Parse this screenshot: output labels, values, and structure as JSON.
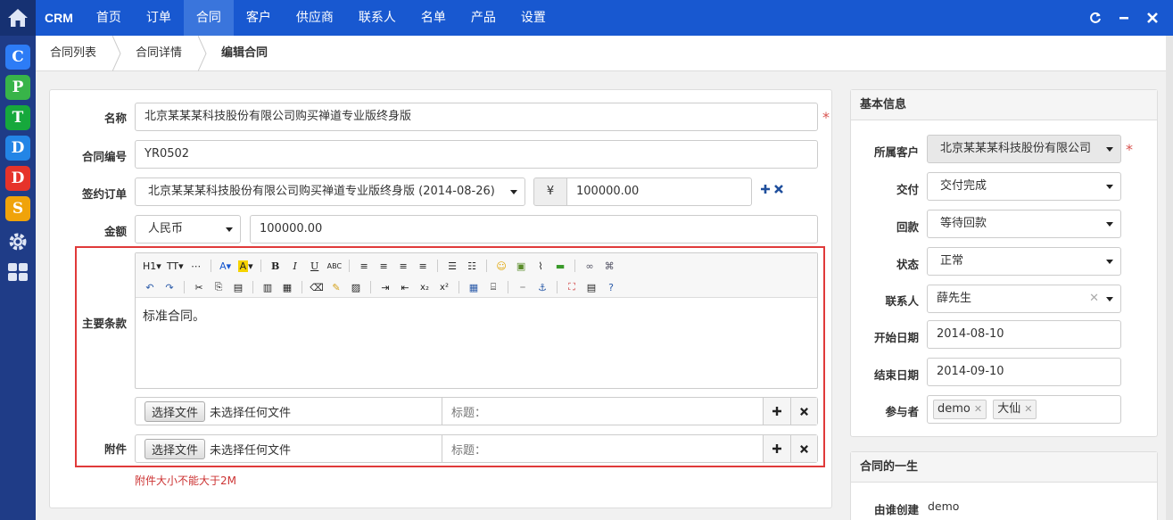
{
  "rail": {
    "apps": [
      {
        "letter": "C",
        "color": "#2d7cf6"
      },
      {
        "letter": "P",
        "color": "#38b449"
      },
      {
        "letter": "T",
        "color": "#16a83c"
      },
      {
        "letter": "D",
        "color": "#2385e6"
      },
      {
        "letter": "D",
        "color": "#e6332a"
      },
      {
        "letter": "S",
        "color": "#f0a30a"
      }
    ]
  },
  "nav": {
    "brand": "CRM",
    "items": [
      "首页",
      "订单",
      "合同",
      "客户",
      "供应商",
      "联系人",
      "名单",
      "产品",
      "设置"
    ],
    "active_index": 2
  },
  "breadcrumb": [
    "合同列表",
    "合同详情",
    "编辑合同"
  ],
  "form": {
    "name_label": "名称",
    "name_value": "北京某某某科技股份有限公司购买禅道专业版终身版",
    "code_label": "合同编号",
    "code_value": "YR0502",
    "order_label": "签约订单",
    "order_value": "北京某某某科技股份有限公司购买禅道专业版终身版 (2014-08-26)",
    "order_currency_symbol": "¥",
    "order_amount": "100000.00",
    "amount_label": "金额",
    "currency_value": "人民币",
    "amount_value": "100000.00",
    "terms_label": "主要条款",
    "terms_text": "标准合同。",
    "attach_label": "附件",
    "file_button": "选择文件",
    "no_file_text": "未选择任何文件",
    "title_placeholder": "标题：",
    "size_warning": "附件大小不能大于2M"
  },
  "editor_toolbar": {
    "heading": "H1",
    "font_size": "TT"
  },
  "basic_info": {
    "header": "基本信息",
    "customer_label": "所属客户",
    "customer_value": "北京某某某科技股份有限公司",
    "delivery_label": "交付",
    "delivery_value": "交付完成",
    "payment_label": "回款",
    "payment_value": "等待回款",
    "status_label": "状态",
    "status_value": "正常",
    "contact_label": "联系人",
    "contact_value": "薛先生",
    "start_label": "开始日期",
    "start_value": "2014-08-10",
    "end_label": "结束日期",
    "end_value": "2014-09-10",
    "participants_label": "参与者",
    "participants": [
      "demo",
      "大仙"
    ]
  },
  "life": {
    "header": "合同的一生",
    "creator_label": "由谁创建",
    "creator_value": "demo"
  }
}
